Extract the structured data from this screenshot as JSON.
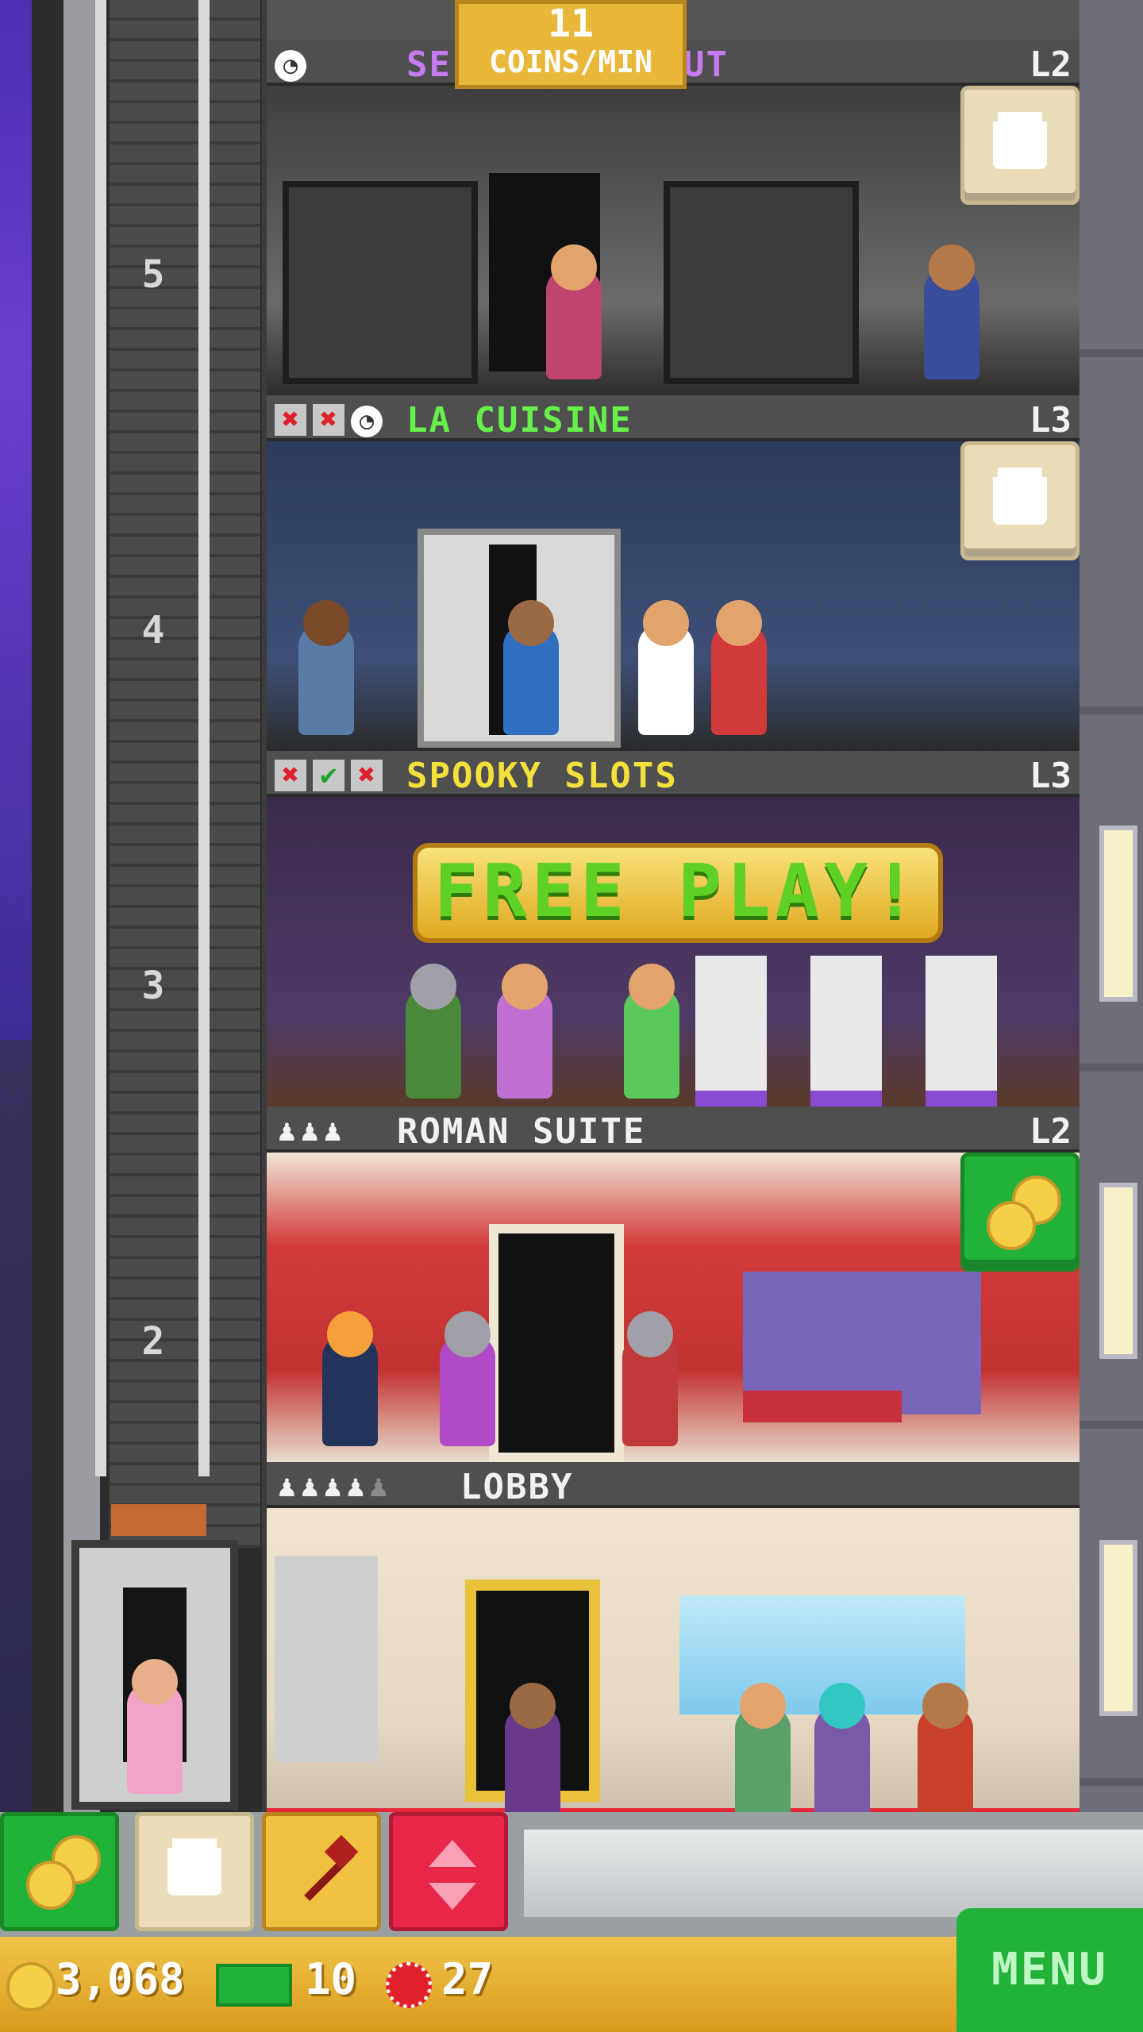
{
  "hud": {
    "coins_per_min_value": "11",
    "coins_per_min_label": "COINS/MIN"
  },
  "floors": [
    {
      "name": "SE",
      "name_tail": "UT",
      "level": "L2",
      "shaft_number": "5"
    },
    {
      "name": "LA CUISINE",
      "level": "L3",
      "shaft_number": "4"
    },
    {
      "name": "SPOOKY SLOTS",
      "level": "L3",
      "shaft_number": "3",
      "banner": "FREE  PLAY!"
    },
    {
      "name": "ROMAN SUITE",
      "level": "L2",
      "shaft_number": "2"
    },
    {
      "name": "LOBBY"
    }
  ],
  "status": {
    "coins": "3,068",
    "bux": "10",
    "chips": "27",
    "menu_label": "MENU"
  },
  "colors": {
    "coin_gold": "#f5cf45",
    "accent_green": "#22b23a",
    "elevator_red": "#e8264a"
  },
  "icons": [
    "clock-icon",
    "cooking-pot-icon",
    "coin-stack-icon",
    "hammer-icon",
    "elevator-arrows-icon",
    "bux-icon",
    "chip-icon",
    "x-mark-icon",
    "check-mark-icon",
    "person-icon"
  ]
}
